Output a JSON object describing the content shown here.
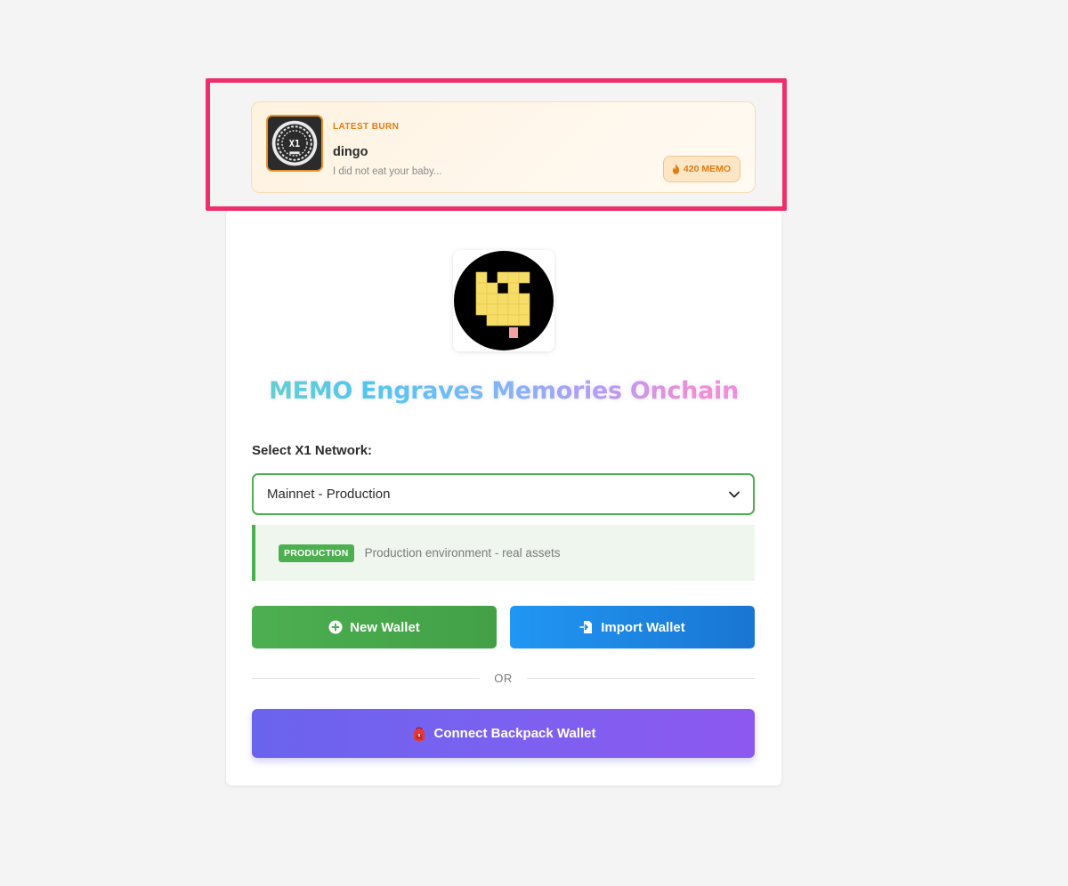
{
  "latest_burn": {
    "tag": "LATEST BURN",
    "name": "dingo",
    "message": "I did not eat your baby...",
    "amount": "420 MEMO",
    "avatar_text": "X1"
  },
  "app": {
    "title": "MEMO Engraves Memories Onchain"
  },
  "network": {
    "label": "Select X1 Network:",
    "selected": "Mainnet - Production",
    "badge": "PRODUCTION",
    "description": "Production environment - real assets"
  },
  "actions": {
    "new_wallet": "New Wallet",
    "import_wallet": "Import Wallet",
    "divider": "OR",
    "connect_backpack": "Connect Backpack Wallet"
  },
  "colors": {
    "highlight": "#ef2f6b",
    "burn_accent": "#e07d12",
    "production_green": "#4caf50",
    "import_blue": "#2196f3",
    "backpack_purple": "#7b61f0"
  },
  "icons": {
    "burn_amount": "flame-icon",
    "select": "chevron-down-icon",
    "new_wallet": "plus-circle-icon",
    "import_wallet": "file-import-icon",
    "backpack": "backpack-icon"
  }
}
